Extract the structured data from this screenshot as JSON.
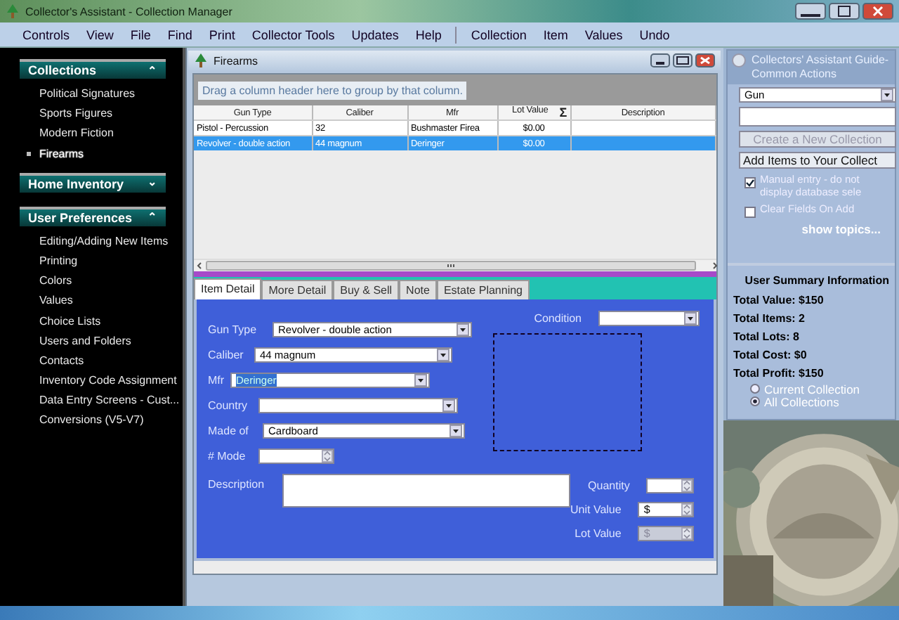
{
  "window": {
    "title": "Collector's Assistant - Collection Manager"
  },
  "menu_groups": [
    [
      "Controls",
      "View",
      "File",
      "Find",
      "Print",
      "Collector Tools",
      "Updates",
      "Help"
    ],
    [
      "Collection",
      "Item",
      "Values",
      "Undo"
    ]
  ],
  "sidebar": {
    "sections": [
      {
        "title": "Collections",
        "expanded": true,
        "toggle": "⌃",
        "items": [
          {
            "label": "Political Signatures",
            "selected": false
          },
          {
            "label": "Sports Figures",
            "selected": false
          },
          {
            "label": "Modern Fiction",
            "selected": false
          },
          {
            "label": "Firearms",
            "selected": true
          }
        ]
      },
      {
        "title": "Home Inventory",
        "expanded": false,
        "toggle": "⌄"
      },
      {
        "title": "User Preferences",
        "expanded": true,
        "toggle": "⌃",
        "items": [
          {
            "label": "Editing/Adding New Items",
            "selected": false
          },
          {
            "label": "Printing",
            "selected": false
          },
          {
            "label": "Colors",
            "selected": false
          },
          {
            "label": "Values",
            "selected": false
          },
          {
            "label": "Choice Lists",
            "selected": false
          },
          {
            "label": "Users and Folders",
            "selected": false
          },
          {
            "label": "Contacts",
            "selected": false
          },
          {
            "label": "Inventory Code Assignment",
            "selected": false
          },
          {
            "label": "Data Entry  Screens  - Cust...",
            "selected": false
          },
          {
            "label": "Conversions (V5-V7)",
            "selected": false
          }
        ]
      }
    ]
  },
  "child_window": {
    "title": "Firearms",
    "group_hint": "Drag a column header here to group by that column.",
    "table": {
      "columns": [
        {
          "label": "Gun Type"
        },
        {
          "label": "Caliber"
        },
        {
          "label": "Mfr"
        },
        {
          "label": "Lot Value",
          "icon_text": "Σ"
        },
        {
          "label": "Description"
        }
      ],
      "rows": [
        {
          "cells": [
            "Pistol - Percussion",
            "32",
            "Bushmaster Firea",
            "$0.00",
            ""
          ],
          "selected": false
        },
        {
          "cells": [
            "Revolver - double action",
            "44 magnum",
            "Deringer",
            "$0.00",
            ""
          ],
          "selected": true
        }
      ]
    },
    "tabs": [
      {
        "label": "Item Detail",
        "selected": true
      },
      {
        "label": "More Detail",
        "selected": false
      },
      {
        "label": "Buy & Sell",
        "selected": false
      },
      {
        "label": "Note",
        "selected": false
      },
      {
        "label": "Estate Planning",
        "selected": false
      }
    ],
    "left_fields": [
      {
        "label": "Gun Type",
        "kind": "select",
        "value": "Revolver - double action",
        "highlighted": false
      },
      {
        "label": "Caliber",
        "kind": "select",
        "value": "44 magnum",
        "highlighted": false
      },
      {
        "label": "Mfr",
        "kind": "select",
        "value": "Deringer",
        "highlighted": true
      },
      {
        "label": "Country",
        "kind": "select"
      },
      {
        "label": "Made of",
        "kind": "select",
        "value": "Cardboard",
        "highlighted": false
      },
      {
        "label": "# Mode",
        "kind": "spin"
      }
    ],
    "condition": {
      "label": "Condition"
    },
    "description": {
      "label": "Description"
    },
    "value_fields": [
      {
        "label": "Quantity",
        "disabled": false
      },
      {
        "label": "Unit Value",
        "value": "$",
        "disabled": false
      },
      {
        "label": "Lot Value",
        "value": "$",
        "disabled": true
      }
    ]
  },
  "guide": {
    "title": "Collectors' Assistant Guide- Common Actions",
    "collection_select": "Gun",
    "buttons": [
      {
        "label": "Create a New Collection",
        "disabled": true
      },
      {
        "label": "Add Items to Your Collect",
        "disabled": false
      }
    ],
    "options": [
      {
        "label": "Manual entry - do not display  database sele",
        "checked": true
      },
      {
        "label": "Clear Fields On Add",
        "checked": false
      }
    ],
    "link": "show topics..."
  },
  "summary": {
    "title": "User Summary Information",
    "lines": [
      "Total Value: $150",
      "Total Items: 2",
      "Total Lots: 8",
      "Total Cost: $0",
      "Total Profit: $150"
    ],
    "scope": [
      {
        "label": "Current Collection",
        "selected": false
      },
      {
        "label": "All Collections",
        "selected": true
      }
    ]
  }
}
